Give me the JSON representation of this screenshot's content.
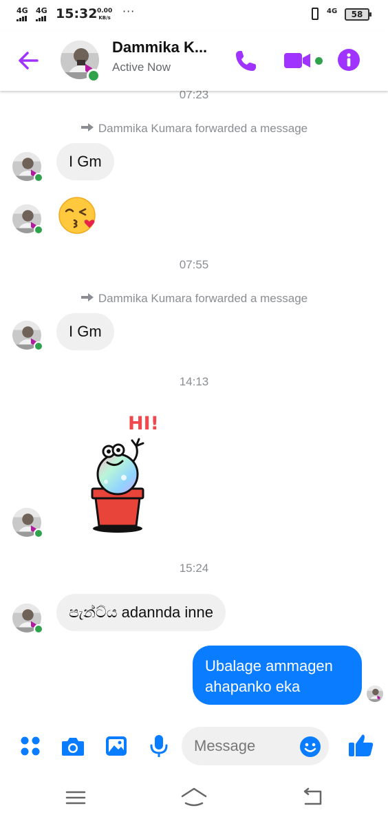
{
  "status_bar": {
    "network_1": "4G",
    "network_2": "4G",
    "time": "15:32",
    "speed_value": "0.00",
    "speed_unit": "KB/s",
    "more": "···",
    "network_3": "4G",
    "battery": "58"
  },
  "header": {
    "name": "Dammika K...",
    "status": "Active Now"
  },
  "conversation": {
    "timestamps": [
      "07:23",
      "07:55",
      "14:13",
      "15:24"
    ],
    "forward_notes": [
      "Dammika Kumara forwarded a message",
      "Dammika Kumara forwarded a message"
    ],
    "messages_in": [
      "I  Gm",
      "😘",
      "I  Gm",
      "පැන්ට්ය adannda inne"
    ],
    "sticker_text": "HI!",
    "messages_out": [
      "Ubalage ammagen ahapanko eka"
    ]
  },
  "composer": {
    "placeholder": "Message"
  },
  "colors": {
    "accent_purple": "#a033ff",
    "messenger_blue": "#0a7cff",
    "online_green": "#31a24c",
    "incoming_bubble": "#f0f0f0"
  },
  "icons": {
    "back": "arrow-left-icon",
    "call": "phone-icon",
    "video": "video-camera-icon",
    "info": "info-icon",
    "apps": "grid-dots-icon",
    "camera": "camera-icon",
    "gallery": "image-icon",
    "mic": "microphone-icon",
    "emoji": "smiley-icon",
    "like": "thumbs-up-icon"
  }
}
